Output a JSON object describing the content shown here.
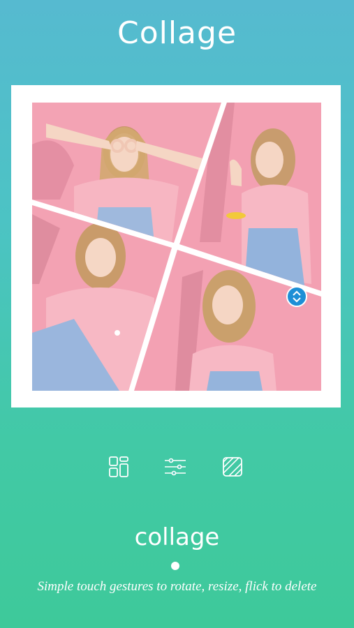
{
  "header": {
    "title": "Collage"
  },
  "colors": {
    "accent": "#1d8fd6",
    "bg_top": "#56bad0",
    "bg_bottom": "#3ec99a",
    "photo_bg": "#f3a0b0"
  },
  "collage": {
    "photos": [
      {
        "name": "photo-top-left",
        "subject": "girl making glasses with hands"
      },
      {
        "name": "photo-top-right",
        "subject": "girl with yellow sunglasses"
      },
      {
        "name": "photo-bottom-left",
        "subject": "girl in overalls"
      },
      {
        "name": "photo-bottom-right",
        "subject": "girl looking at camera"
      }
    ],
    "handle_icon": "resize-vertical-icon"
  },
  "toolbar": {
    "items": [
      {
        "icon": "layout-grid-icon"
      },
      {
        "icon": "adjust-sliders-icon"
      },
      {
        "icon": "pattern-background-icon"
      }
    ]
  },
  "onboarding": {
    "caption": "collage",
    "page_indicator": {
      "current": 1,
      "total": 1
    },
    "description": "Simple touch gestures to rotate, resize, flick to delete"
  }
}
